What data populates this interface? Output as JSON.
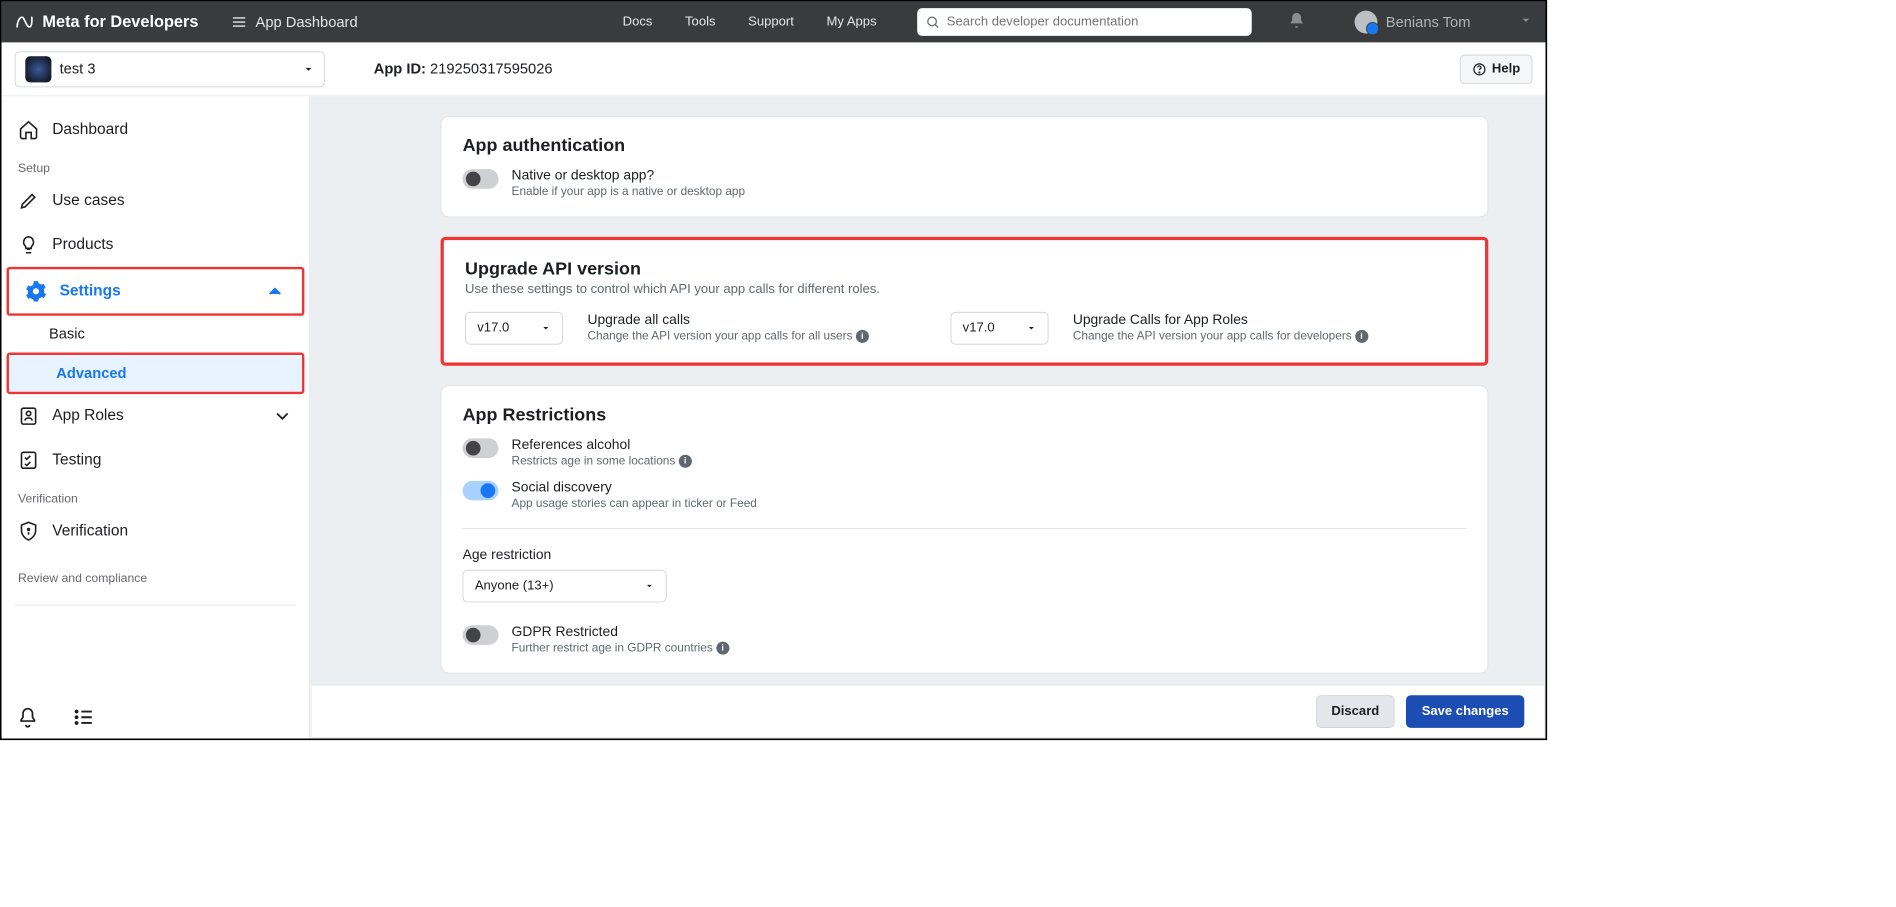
{
  "topnav": {
    "brand": "Meta for Developers",
    "dashboard_label": "App Dashboard",
    "links": {
      "docs": "Docs",
      "tools": "Tools",
      "support": "Support",
      "myapps": "My Apps"
    },
    "search_placeholder": "Search developer documentation",
    "user_name": "Benians Tom"
  },
  "appbar": {
    "app_name": "test 3",
    "appid_label": "App ID:",
    "appid_value": "219250317595026",
    "help_label": "Help"
  },
  "sidebar": {
    "dashboard": "Dashboard",
    "setup_label": "Setup",
    "use_cases": "Use cases",
    "products": "Products",
    "settings": "Settings",
    "settings_basic": "Basic",
    "settings_advanced": "Advanced",
    "app_roles": "App Roles",
    "testing": "Testing",
    "verification_label": "Verification",
    "verification": "Verification",
    "review": "Review and compliance"
  },
  "main": {
    "auth": {
      "title": "App authentication",
      "native_label": "Native or desktop app?",
      "native_sub": "Enable if your app is a native or desktop app"
    },
    "upgrade": {
      "title": "Upgrade API version",
      "desc": "Use these settings to control which API your app calls for different roles.",
      "v1": "v17.0",
      "all_label": "Upgrade all calls",
      "all_sub": "Change the API version your app calls for all users",
      "v2": "v17.0",
      "roles_label": "Upgrade Calls for App Roles",
      "roles_sub": "Change the API version your app calls for developers"
    },
    "restrictions": {
      "title": "App Restrictions",
      "alcohol_label": "References alcohol",
      "alcohol_sub": "Restricts age in some locations",
      "social_label": "Social discovery",
      "social_sub": "App usage stories can appear in ticker or Feed",
      "age_label": "Age restriction",
      "age_value": "Anyone (13+)",
      "gdpr_label": "GDPR Restricted",
      "gdpr_sub": "Further restrict age in GDPR countries"
    }
  },
  "footer": {
    "discard": "Discard",
    "save": "Save changes"
  }
}
